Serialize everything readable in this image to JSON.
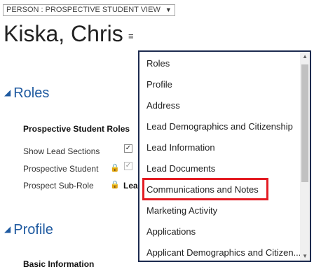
{
  "form_selector": {
    "label": "PERSON : PROSPECTIVE STUDENT VIEW",
    "caret": "▼"
  },
  "record": {
    "title": "Kiska, Chris",
    "nav_icon": "≡"
  },
  "sections": {
    "roles": {
      "title": "Roles",
      "tri": "◢",
      "subheading": "Prospective Student Roles",
      "fields": [
        {
          "label": "Show Lead Sections"
        },
        {
          "label": "Prospective Student"
        },
        {
          "label": "Prospect Sub-Role",
          "value": "Lead"
        }
      ]
    },
    "profile": {
      "title": "Profile",
      "tri": "◢",
      "subheading": "Basic Information"
    }
  },
  "nav_menu": {
    "items": [
      "Roles",
      "Profile",
      "Address",
      "Lead Demographics and Citizenship",
      "Lead Information",
      "Lead Documents",
      "Communications and Notes",
      "Marketing Activity",
      "Applications",
      "Applicant Demographics and Citizen..."
    ],
    "highlighted": "Communications and Notes"
  },
  "icons": {
    "lock": "🔒",
    "check": "✓"
  }
}
